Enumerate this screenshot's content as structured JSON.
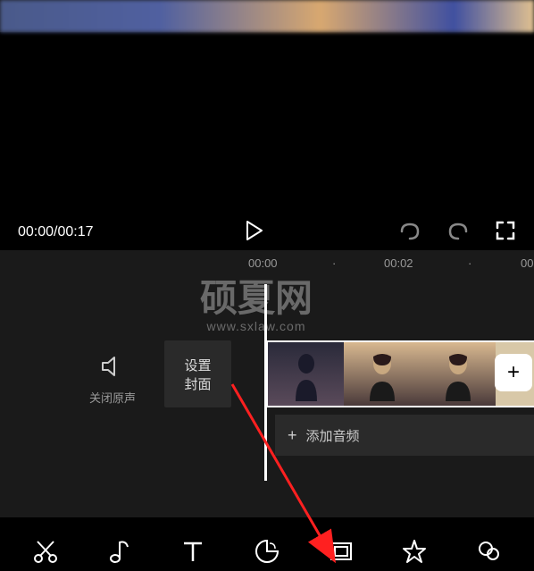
{
  "playback": {
    "time_current": "00:00",
    "time_total": "00:17",
    "time_display": "00:00/00:17"
  },
  "ruler": {
    "marks": [
      "00:00",
      "·",
      "00:02",
      "·",
      "00"
    ],
    "dot": "·"
  },
  "watermark": {
    "title": "硕夏网",
    "subtitle": "www.sxlaw.com"
  },
  "timeline": {
    "mute_label": "关闭原声",
    "cover_line1": "设置",
    "cover_line2": "封面",
    "add_clip_label": "+",
    "add_audio_label": "添加音频",
    "add_audio_plus": "+"
  },
  "toolbar": {
    "items": [
      "cut",
      "music",
      "text",
      "sticker",
      "picture",
      "effect",
      "filter"
    ]
  }
}
